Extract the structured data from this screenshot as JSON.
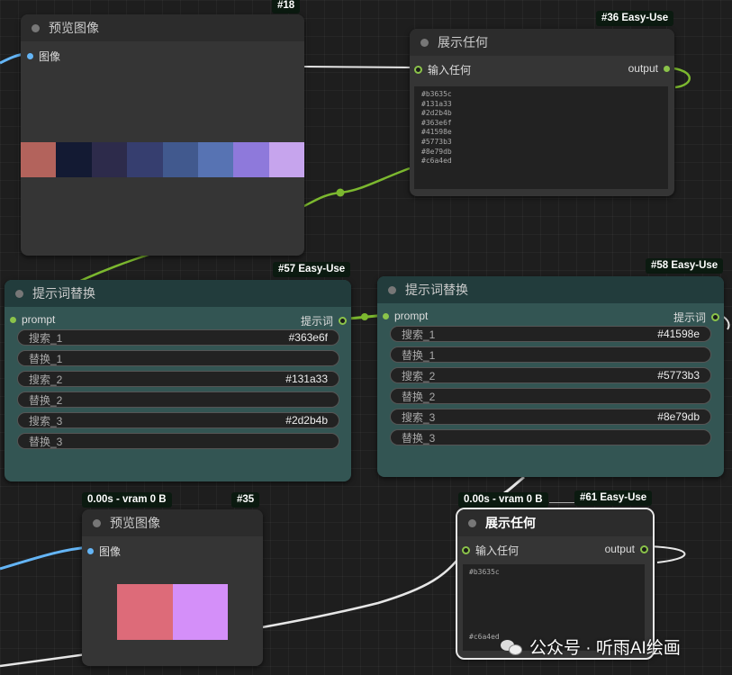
{
  "nodes": {
    "n18": {
      "badge": "#18",
      "title": "预览图像",
      "input_label": "图像",
      "swatches": [
        "#b3635c",
        "#131a33",
        "#2d2b4b",
        "#363e6f",
        "#41598e",
        "#5773b3",
        "#8e79db",
        "#c6a4ed"
      ]
    },
    "n36": {
      "badge": "#36 Easy-Use",
      "title": "展示任何",
      "input_label": "输入任何",
      "output_label": "output",
      "text_lines": [
        "#b3635c",
        "#131a33",
        "#2d2b4b",
        "#363e6f",
        "#41598e",
        "#5773b3",
        "#8e79db",
        "#c6a4ed"
      ]
    },
    "n57": {
      "badge": "#57 Easy-Use",
      "title": "提示词替换",
      "input_label": "prompt",
      "output_label": "提示词",
      "widgets": [
        {
          "label": "搜索_1",
          "value": "#363e6f"
        },
        {
          "label": "替换_1",
          "value": ""
        },
        {
          "label": "搜索_2",
          "value": "#131a33"
        },
        {
          "label": "替换_2",
          "value": ""
        },
        {
          "label": "搜索_3",
          "value": "#2d2b4b"
        },
        {
          "label": "替换_3",
          "value": ""
        }
      ]
    },
    "n58": {
      "badge": "#58 Easy-Use",
      "title": "提示词替换",
      "input_label": "prompt",
      "output_label": "提示词",
      "widgets": [
        {
          "label": "搜索_1",
          "value": "#41598e"
        },
        {
          "label": "替换_1",
          "value": ""
        },
        {
          "label": "搜索_2",
          "value": "#5773b3"
        },
        {
          "label": "替换_2",
          "value": ""
        },
        {
          "label": "搜索_3",
          "value": "#8e79db"
        },
        {
          "label": "替换_3",
          "value": ""
        }
      ]
    },
    "n35": {
      "timing": "0.00s - vram 0 B",
      "badge": "#35",
      "title": "预览图像",
      "input_label": "图像",
      "swatches": [
        "#dd6b79",
        "#d48ff9"
      ]
    },
    "n61": {
      "timing": "0.00s - vram 0 B",
      "badge": "#61 Easy-Use",
      "title": "展示任何",
      "input_label": "输入任何",
      "output_label": "output",
      "text_top": "#b3635c",
      "text_bottom": "#c6a4ed"
    }
  },
  "watermark": "公众号 · 听雨AI绘画",
  "colors": {
    "wire_green": "#7cb82f",
    "wire_white": "#e6e6e6",
    "wire_blue": "#64b5f6",
    "slot_green": "#8bc34a",
    "node_teal": "#335553",
    "node_gray": "#353535"
  }
}
